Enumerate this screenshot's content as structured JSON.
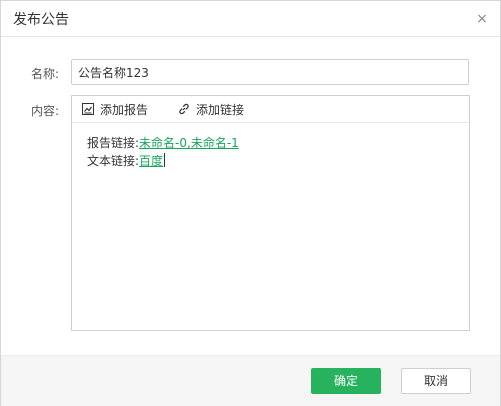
{
  "dialog": {
    "title": "发布公告",
    "close_icon": "×"
  },
  "form": {
    "name_label": "名称:",
    "name_value": "公告名称123",
    "content_label": "内容:"
  },
  "editor": {
    "toolbar": {
      "add_report_label": "添加报告",
      "add_report_icon": "report-icon",
      "add_link_label": "添加链接",
      "add_link_icon": "link-icon"
    },
    "content": {
      "report_link_label": "报告链接:",
      "report_links": [
        "未命名-0",
        "未命名-1"
      ],
      "report_links_separator": ",",
      "text_link_label": "文本链接:",
      "text_link": "百度"
    }
  },
  "footer": {
    "confirm_label": "确定",
    "cancel_label": "取消"
  },
  "colors": {
    "accent": "#27b35d",
    "link": "#1aa55a"
  }
}
